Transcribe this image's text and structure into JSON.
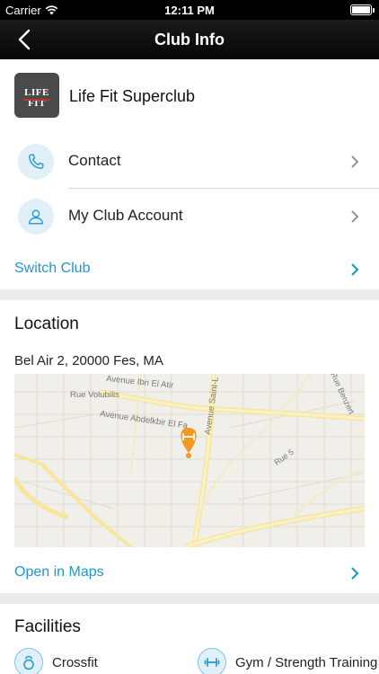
{
  "status_bar": {
    "carrier": "Carrier",
    "time": "12:11 PM"
  },
  "nav": {
    "title": "Club Info"
  },
  "club": {
    "logo_text": "LIFE FIT",
    "name": "Life Fit Superclub",
    "rows": [
      {
        "label": "Contact",
        "icon": "phone-icon"
      },
      {
        "label": "My Club Account",
        "icon": "user-icon"
      }
    ],
    "switch_label": "Switch Club"
  },
  "location": {
    "title": "Location",
    "address": "Bel Air 2, 20000 Fes, MA",
    "map_labels": {
      "street_1": "Avenue Ibn El Atir",
      "street_2": "Rue Volubilis",
      "street_3": "Avenue Abdelkbir El Fa",
      "street_4": "Avenue Saint-L",
      "street_5": "Rue Benzert",
      "street_6": "Rue 5"
    },
    "open_maps_label": "Open in Maps"
  },
  "facilities": {
    "title": "Facilities",
    "items": [
      {
        "label": "Crossfit",
        "icon": "kettlebell-icon"
      },
      {
        "label": "Gym / Strength Training",
        "icon": "dumbbell-icon"
      }
    ]
  },
  "colors": {
    "accent": "#1f97cf",
    "icon_bg": "#e1f0f8",
    "pin": "#f29a1f"
  }
}
